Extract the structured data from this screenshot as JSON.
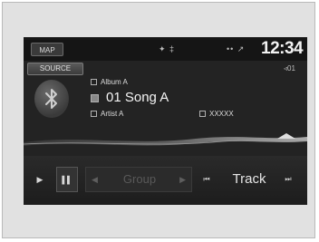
{
  "status": {
    "map_label": "MAP",
    "center_icons": "✦ ‡",
    "right_icons": "•• ↗",
    "clock": "12:34"
  },
  "source": {
    "label": "SOURCE",
    "track_number": "◃01"
  },
  "now_playing": {
    "album": "Album A",
    "song": "01 Song A",
    "artist": "Artist A",
    "extra": "XXXXX"
  },
  "controls": {
    "play": "▶",
    "pause": "▌▌",
    "group_prev": "◀",
    "group_label": "Group",
    "group_next": "▶",
    "track_prev": "⏮",
    "track_label": "Track",
    "track_next": "⏭"
  }
}
